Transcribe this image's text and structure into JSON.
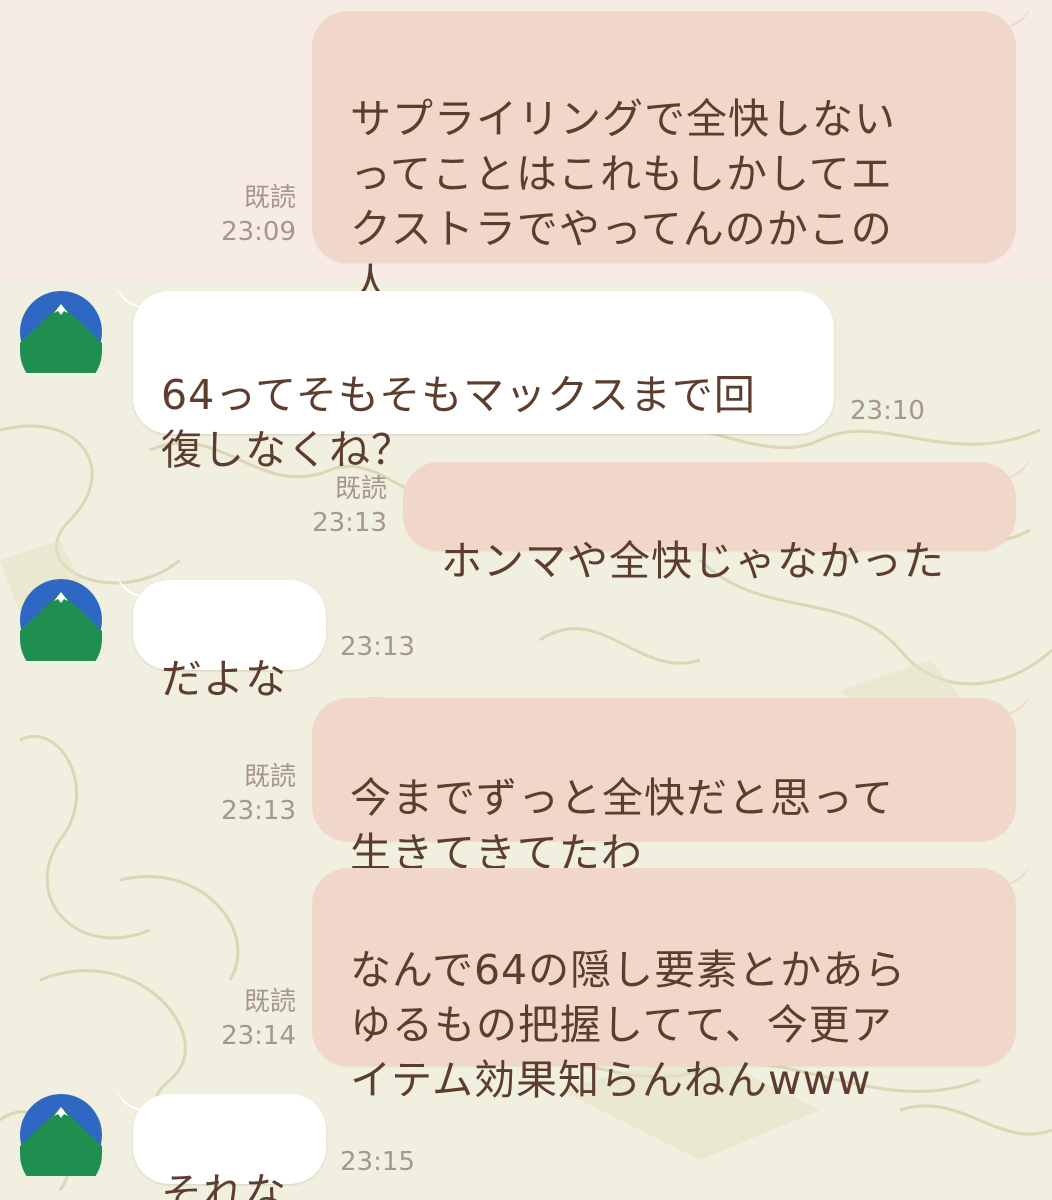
{
  "conversation": {
    "messages": [
      {
        "side": "sent",
        "text": "サプライリングで全快しない\nってことはこれもしかしてエ\nクストラでやってんのかこの\n人",
        "read_label": "既読",
        "time": "23:09"
      },
      {
        "side": "recv",
        "text": "64ってそもそもマックスまで回\n復しなくね？",
        "time": "23:10"
      },
      {
        "side": "sent",
        "text": "ホンマや全快じゃなかった",
        "read_label": "既読",
        "time": "23:13"
      },
      {
        "side": "recv",
        "text": "だよな",
        "time": "23:13"
      },
      {
        "side": "sent",
        "text": "今までずっと全快だと思って\n生きてきてたわ",
        "read_label": "既読",
        "time": "23:13"
      },
      {
        "side": "sent",
        "text": "なんで64の隠し要素とかあら\nゆるもの把握してて、今更ア\nイテム効果知らんねんwww",
        "read_label": "既読",
        "time": "23:14"
      },
      {
        "side": "recv",
        "text": "それな",
        "time": "23:15"
      }
    ]
  },
  "colors": {
    "sent_bubble": "#f1d7c9",
    "recv_bubble": "#ffffff",
    "text": "#5c3d2e",
    "meta_text": "#a6978d",
    "avatar_blue": "#2f68c2",
    "avatar_green": "#1f8f51"
  },
  "icons": {
    "avatar": "mountain-avatar-icon"
  }
}
